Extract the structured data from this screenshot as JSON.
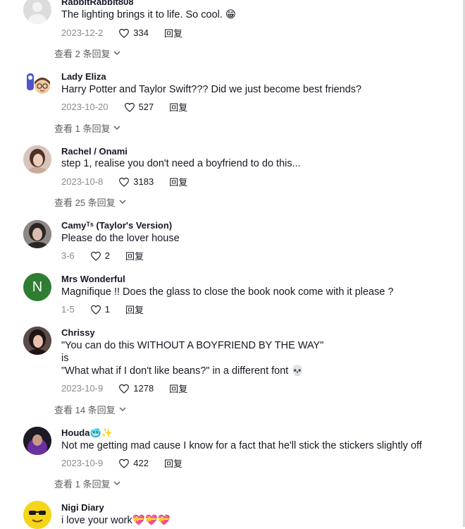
{
  "comments": [
    {
      "name": "RabbitRabbit808",
      "lines": [
        "The lighting brings it to life. So cool. 😁"
      ],
      "date": "2023-12-2",
      "likes": "334",
      "reply": "回复",
      "view_replies": "查看 2 条回复",
      "avatar": "default-gray"
    },
    {
      "name": "Lady Eliza",
      "lines": [
        "Harry Potter and Taylor Swift??? Did we just become best friends?"
      ],
      "date": "2023-10-20",
      "likes": "527",
      "reply": "回复",
      "view_replies": "查看 1 条回复",
      "avatar": "cartoon"
    },
    {
      "name": "Rachel / Onami",
      "lines": [
        "step 1, realise you don't need a boyfriend to do this..."
      ],
      "date": "2023-10-8",
      "likes": "3183",
      "reply": "回复",
      "view_replies": "查看 25 条回复",
      "avatar": "photo"
    },
    {
      "name": "Camyᵀˢ (Taylor's Version)",
      "lines": [
        "Please do the lover house"
      ],
      "date": "3-6",
      "likes": "2",
      "reply": "回复",
      "avatar": "photo-dark"
    },
    {
      "name": "Mrs Wonderful",
      "lines": [
        "Magnifique !! Does the glass to close the book nook come with it please ?"
      ],
      "date": "1-5",
      "likes": "1",
      "reply": "回复",
      "avatar": "letter",
      "avatar_letter": "N",
      "avatar_color": "#2e7d32"
    },
    {
      "name": "Chrissy",
      "lines": [
        "\"You can do this WITHOUT A BOYFRIEND BY THE WAY\"",
        "is",
        "\"What what if I don't like beans?\" in a different font 💀"
      ],
      "date": "2023-10-9",
      "likes": "1278",
      "reply": "回复",
      "view_replies": "查看 14 条回复",
      "avatar": "photo"
    },
    {
      "name": "Houda🥶✨",
      "lines": [
        "Not me getting mad cause I know for a fact that he'll stick the stickers slightly off"
      ],
      "date": "2023-10-9",
      "likes": "422",
      "reply": "回复",
      "view_replies": "查看 1 条回复",
      "avatar": "photo-purple"
    },
    {
      "name": "Nigi Diary",
      "lines": [
        "i love your work💝💝💝"
      ],
      "avatar": "emoji-sunglasses"
    }
  ],
  "icons": {
    "like": "heart-outline-icon",
    "expand": "chevron-down-icon"
  },
  "colors": {
    "text": "#161823",
    "meta": "#8a8b91",
    "view_replies": "#5c5d63"
  }
}
